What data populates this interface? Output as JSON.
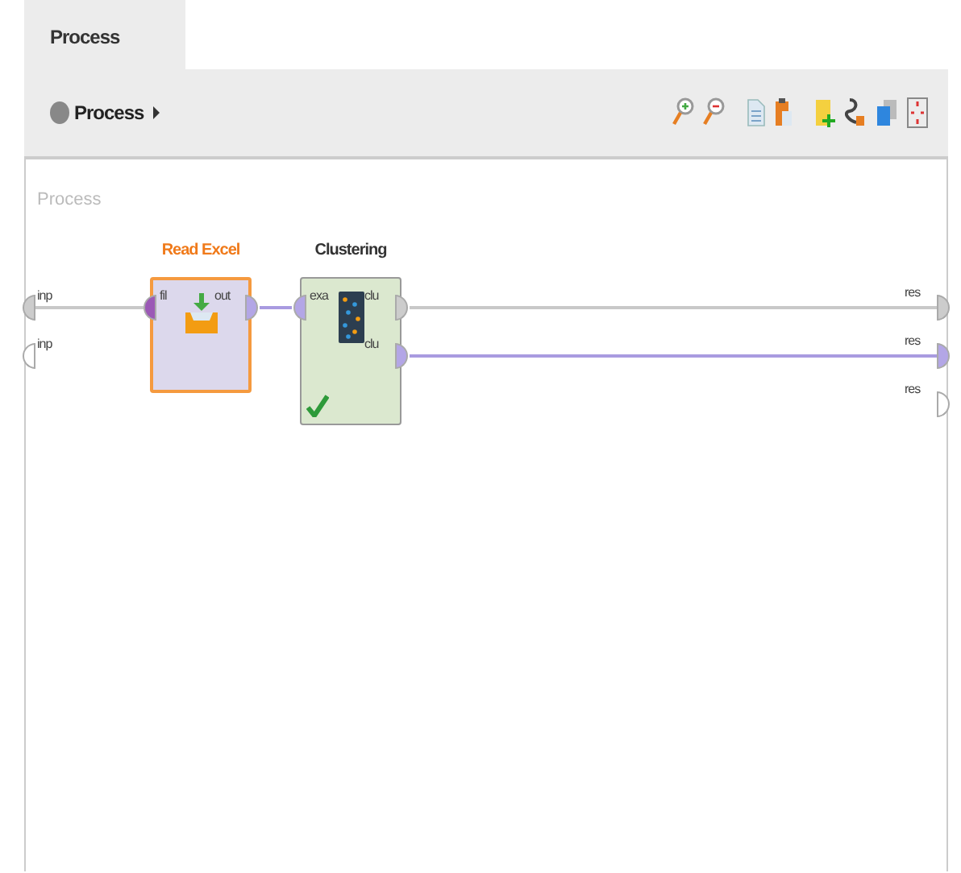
{
  "tabs": [
    {
      "label": "Process",
      "selected": true
    }
  ],
  "breadcrumb": {
    "label": "Process"
  },
  "canvas": {
    "title": "Process",
    "input_ports": [
      {
        "label": "inp",
        "color": "#cccccc"
      },
      {
        "label": "inp",
        "color": "#ffffff"
      }
    ],
    "result_ports": [
      {
        "label": "res",
        "color": "#cccccc"
      },
      {
        "label": "res",
        "color": "#b3a6e6"
      },
      {
        "label": "res",
        "color": "#ffffff"
      }
    ],
    "operators": [
      {
        "kind": "read",
        "name": "Read Excel",
        "selected": true,
        "executed": false,
        "inputs": [
          {
            "label": "fil",
            "color": "#9b59b6"
          }
        ],
        "outputs": [
          {
            "label": "out",
            "color": "#b3a6e6"
          }
        ]
      },
      {
        "kind": "clustering",
        "name": "Clustering",
        "selected": false,
        "executed": true,
        "inputs": [
          {
            "label": "exa",
            "color": "#b3a6e6"
          }
        ],
        "outputs": [
          {
            "label": "clu",
            "color": "#cccccc"
          },
          {
            "label": "clu",
            "color": "#b3a6e6"
          }
        ]
      }
    ]
  }
}
